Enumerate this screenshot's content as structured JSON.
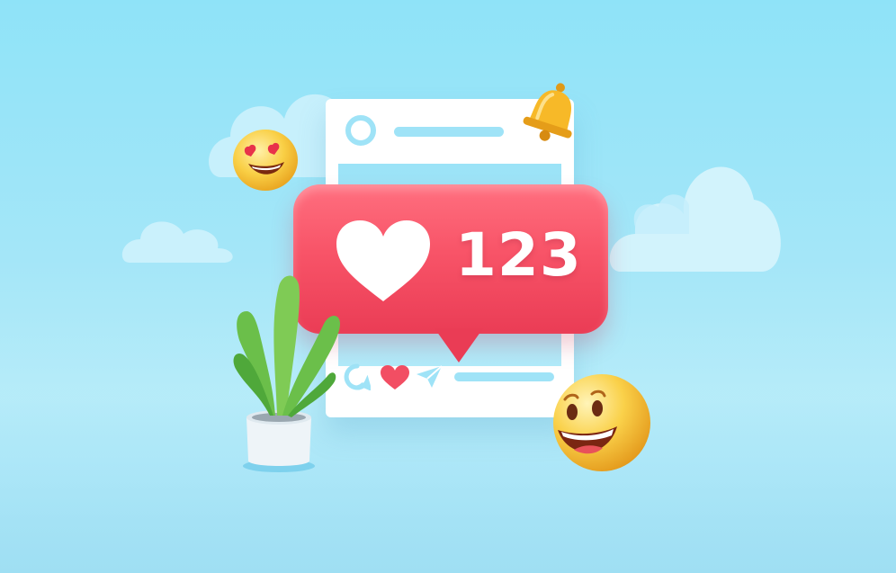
{
  "like_notification": {
    "count": "123",
    "icon": "heart-icon"
  },
  "post_card": {
    "footer_icons": [
      "comment-icon",
      "heart-icon",
      "send-icon"
    ]
  },
  "decorations": {
    "emojis": [
      "heart-eyes-emoji",
      "grinning-emoji"
    ],
    "bell": "bell-icon",
    "plant": "potted-plant"
  },
  "colors": {
    "background": "#8fe3f8",
    "accent_red": "#f24e63",
    "card": "#ffffff",
    "light_blue": "#9fe3f7",
    "emoji_yellow": "#f8c93a"
  }
}
